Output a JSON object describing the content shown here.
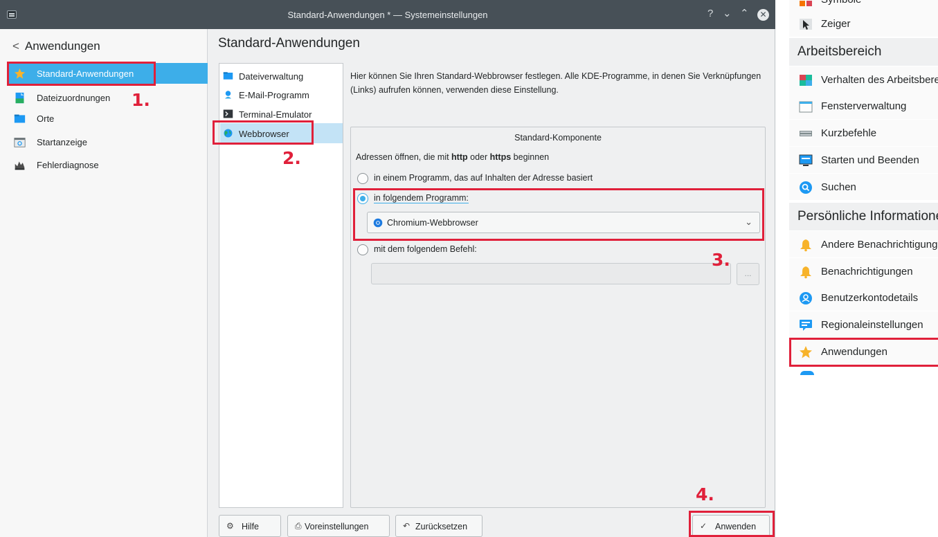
{
  "window": {
    "title": "Standard-Anwendungen * — Systemeinstellungen",
    "help_glyph": "?",
    "min_glyph": "⌄",
    "max_glyph": "⌃",
    "close_glyph": "✕"
  },
  "sidebar": {
    "back_label": "Anwendungen",
    "back_glyph": "<",
    "items": [
      {
        "label": "Standard-Anwendungen",
        "icon": "star-icon"
      },
      {
        "label": "Dateizuordnungen",
        "icon": "file-associations-icon"
      },
      {
        "label": "Orte",
        "icon": "folder-icon"
      },
      {
        "label": "Startanzeige",
        "icon": "launch-feedback-icon"
      },
      {
        "label": "Fehlerdiagnose",
        "icon": "crash-icon"
      }
    ]
  },
  "content": {
    "title": "Standard-Anwendungen",
    "sub_items": [
      {
        "label": "Dateiverwaltung",
        "icon": "folder-icon"
      },
      {
        "label": "E-Mail-Programm",
        "icon": "mail-client-icon"
      },
      {
        "label": "Terminal-Emulator",
        "icon": "terminal-icon"
      },
      {
        "label": "Webbrowser",
        "icon": "web-browser-icon"
      }
    ],
    "description": "Hier können Sie Ihren Standard-Webbrowser festlegen. Alle KDE-Programme, in denen Sie Verknüpfungen (Links) aufrufen können, verwenden diese Einstellung.",
    "group_title": "Standard-Komponente",
    "prompt_prefix": "Adressen öffnen, die mit ",
    "prompt_http": "http",
    "prompt_or": " oder ",
    "prompt_https": "https",
    "prompt_suffix": " beginnen",
    "option_content": "in einem Programm, das auf Inhalten der Adresse basiert",
    "option_program": "in folgendem Programm:",
    "program_selected": "Chromium-Webbrowser",
    "option_command": "mit dem folgendem Befehl:",
    "command_value": "",
    "browse_label": "...",
    "selected_option": "option_program"
  },
  "buttons": {
    "help": "Hilfe",
    "defaults": "Voreinstellungen",
    "reset": "Zurücksetzen",
    "apply": "Anwenden"
  },
  "annotations": [
    "1.",
    "2.",
    "3.",
    "4."
  ],
  "right_panel": {
    "items": [
      {
        "type": "item",
        "label": "Symbole"
      },
      {
        "type": "item",
        "label": "Zeiger"
      },
      {
        "type": "header",
        "label": "Arbeitsbereich"
      },
      {
        "type": "item",
        "label": "Verhalten des Arbeitsbereichs"
      },
      {
        "type": "item",
        "label": "Fensterverwaltung"
      },
      {
        "type": "item",
        "label": "Kurzbefehle"
      },
      {
        "type": "item",
        "label": "Starten und Beenden"
      },
      {
        "type": "item",
        "label": "Suchen"
      },
      {
        "type": "header",
        "label": "Persönliche Informationen"
      },
      {
        "type": "item",
        "label": "Andere Benachrichtigungen"
      },
      {
        "type": "item",
        "label": "Benachrichtigungen"
      },
      {
        "type": "item",
        "label": "Benutzerkontodetails"
      },
      {
        "type": "item",
        "label": "Regionaleinstellungen"
      },
      {
        "type": "item",
        "label": "Anwendungen"
      }
    ]
  },
  "colors": {
    "accent": "#3daee9",
    "annotation_red": "#e0203a",
    "titlebar": "#475057"
  }
}
